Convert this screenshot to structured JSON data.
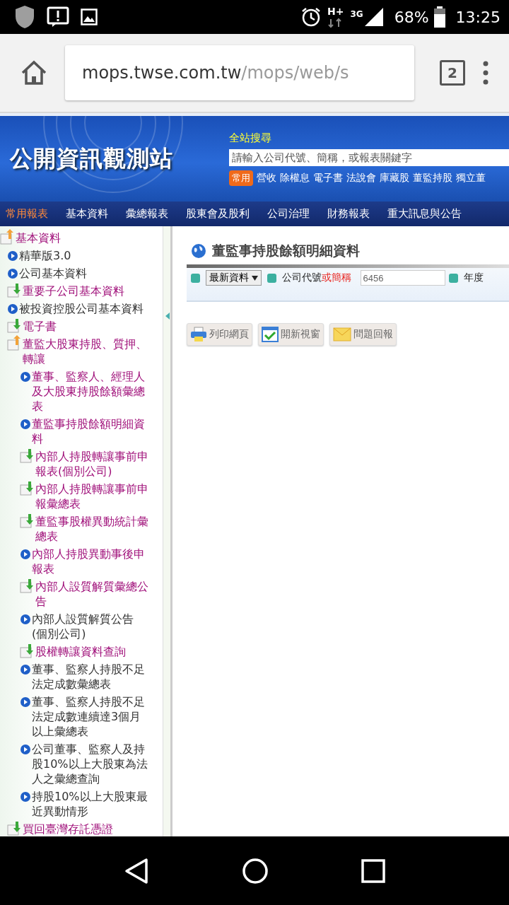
{
  "status_bar": {
    "data_type": "H+",
    "network": "3G",
    "battery": "68%",
    "time": "13:25"
  },
  "browser": {
    "url_host": "mops.twse.com.tw",
    "url_path": "/mops/web/s",
    "tab_count": "2"
  },
  "header": {
    "logo": "公開資訊觀測站",
    "search_title": "全站搜尋",
    "search": {
      "placeholder": "請輸入公司代號、簡稱，或報表關鍵字"
    },
    "quick_badge": "常用",
    "quick_links": [
      "營收",
      "除權息",
      "電子書",
      "法說會",
      "庫藏股",
      "董監持股",
      "獨立董"
    ]
  },
  "nav": [
    {
      "label": "常用報表",
      "selected": true
    },
    {
      "label": "基本資料",
      "selected": false
    },
    {
      "label": "彙總報表",
      "selected": false
    },
    {
      "label": "股東會及股利",
      "selected": false
    },
    {
      "label": "公司治理",
      "selected": false
    },
    {
      "label": "財務報表",
      "selected": false
    },
    {
      "label": "重大訊息與公告",
      "selected": false
    }
  ],
  "sidebar": {
    "tree": [
      {
        "label": "基本資料",
        "kind": "folder",
        "expanded": true,
        "visited": true,
        "children": [
          {
            "label": "精華版3.0",
            "kind": "page",
            "visited": false
          },
          {
            "label": "公司基本資料",
            "kind": "page",
            "visited": false
          },
          {
            "label": "重要子公司基本資料",
            "kind": "folder",
            "expanded": false,
            "visited": true
          },
          {
            "label": "被投資控股公司基本資料",
            "kind": "page",
            "visited": false
          },
          {
            "label": "電子書",
            "kind": "folder",
            "expanded": false,
            "visited": true
          },
          {
            "label": "董監大股東持股、質押、轉讓",
            "kind": "folder",
            "expanded": true,
            "visited": true,
            "children": [
              {
                "label": "董事、監察人、經理人及大股東持股餘額彙總表",
                "kind": "page",
                "visited": true
              },
              {
                "label": "董監事持股餘額明細資料",
                "kind": "page",
                "visited": true
              },
              {
                "label": "內部人持股轉讓事前申報表(個別公司)",
                "kind": "folder",
                "expanded": false,
                "visited": true
              },
              {
                "label": "內部人持股轉讓事前申報彙總表",
                "kind": "folder",
                "expanded": false,
                "visited": true
              },
              {
                "label": "董監事股權異動統計彙總表",
                "kind": "folder",
                "expanded": false,
                "visited": true
              },
              {
                "label": "內部人持股異動事後申報表",
                "kind": "page",
                "visited": true
              },
              {
                "label": "內部人設質解質彙總公告",
                "kind": "folder",
                "expanded": false,
                "visited": true
              },
              {
                "label": "內部人設質解質公告(個別公司)",
                "kind": "page",
                "visited": false
              },
              {
                "label": "股權轉讓資料查詢",
                "kind": "folder",
                "expanded": false,
                "visited": true
              },
              {
                "label": "董事、監察人持股不足法定成數彙總表",
                "kind": "page",
                "visited": false
              },
              {
                "label": "董事、監察人持股不足法定成數連續達3個月以上彙總表",
                "kind": "page",
                "visited": false
              },
              {
                "label": "公司董事、監察人及持股10%以上大股東為法人之彙總查詢",
                "kind": "page",
                "visited": false
              },
              {
                "label": "持股10%以上大股東最近異動情形",
                "kind": "page",
                "visited": false
              }
            ]
          },
          {
            "label": "買回臺灣存託憑證",
            "kind": "folder",
            "expanded": false,
            "visited": true
          }
        ]
      }
    ]
  },
  "main": {
    "title": "董監事持股餘額明細資料",
    "select": "最新資料",
    "code_label": "公司代號",
    "code_label_alt": "或簡稱",
    "code_value": "6456",
    "year_label": "年度",
    "buttons": [
      "列印網頁",
      "開新視窗",
      "問題回報"
    ]
  }
}
